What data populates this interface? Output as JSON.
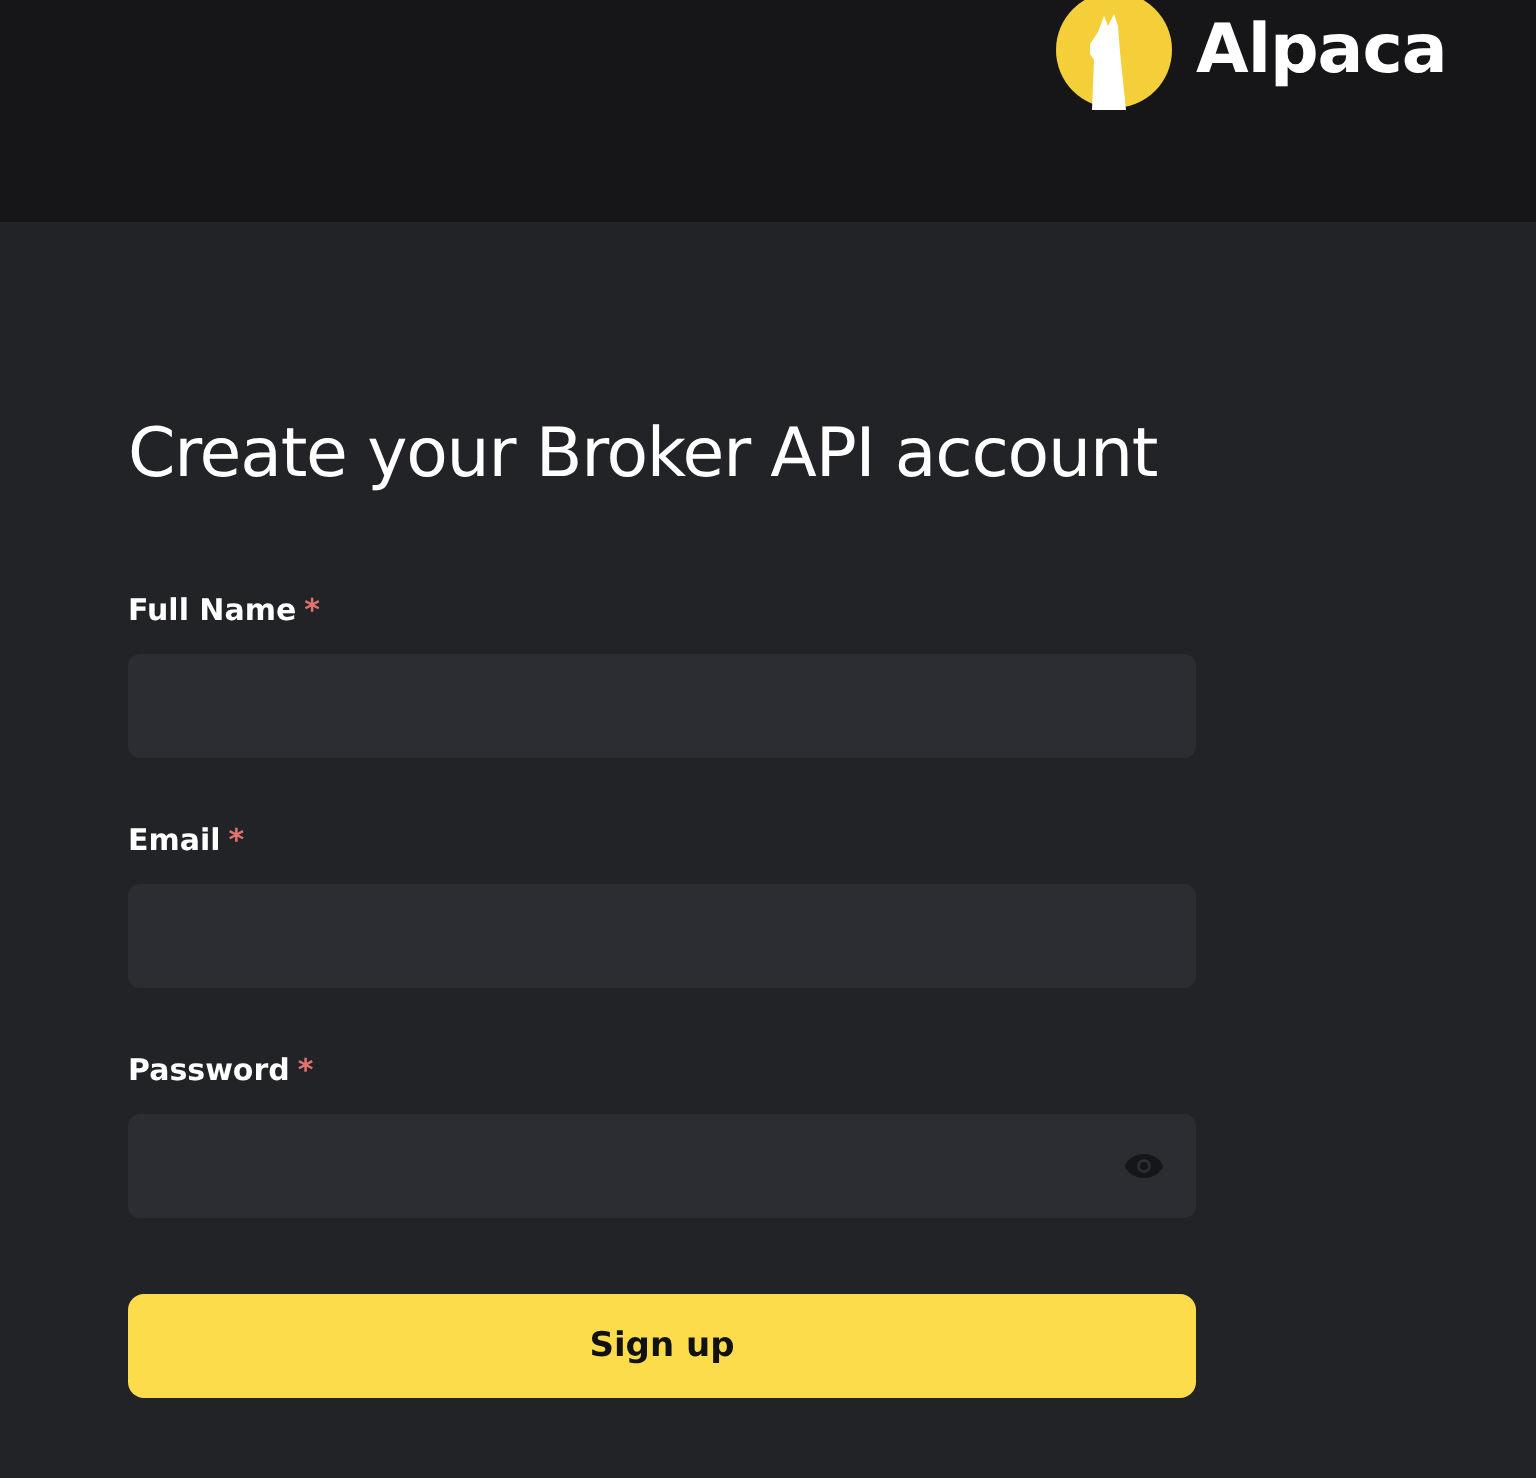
{
  "header": {
    "brand": "Alpaca"
  },
  "form": {
    "title": "Create your Broker API account",
    "fields": [
      {
        "label": "Full Name",
        "marker": "*",
        "kind": "text"
      },
      {
        "label": "Email",
        "marker": "*",
        "kind": "text"
      },
      {
        "label": "Password",
        "marker": "*",
        "kind": "password"
      }
    ],
    "submit": "Sign up"
  }
}
